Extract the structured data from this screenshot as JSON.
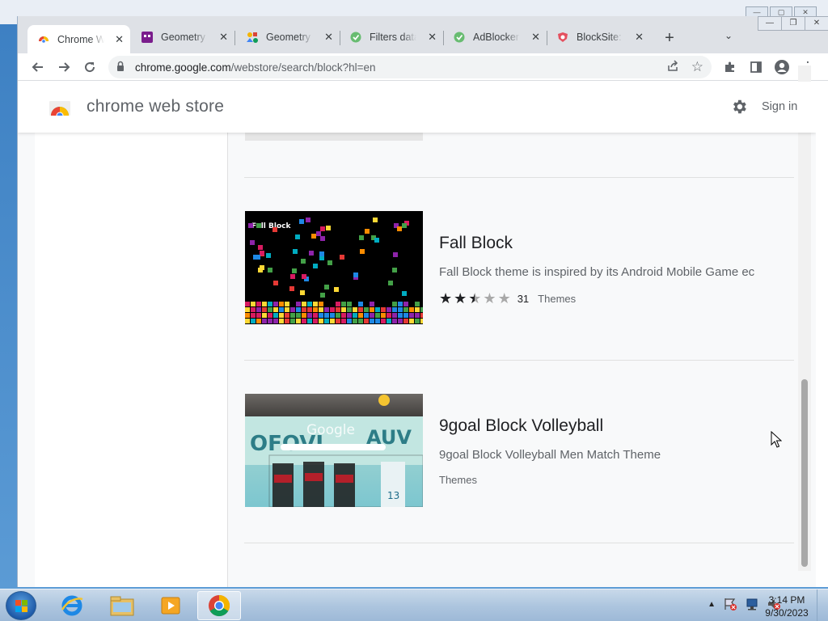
{
  "browser": {
    "tabs": [
      {
        "label": "Chrome Web Store",
        "active": true
      },
      {
        "label": "Geometry Dash",
        "active": false
      },
      {
        "label": "Geometry Dash",
        "active": false
      },
      {
        "label": "Filters database",
        "active": false
      },
      {
        "label": "AdBlocker Stopper",
        "active": false
      },
      {
        "label": "BlockSite: Free",
        "active": false
      }
    ],
    "new_tab_label": "+",
    "url_host": "chrome.google.com",
    "url_rest": "/webstore/search/block?hl=en"
  },
  "store": {
    "title": "chrome web store",
    "sign_in": "Sign in"
  },
  "results": [
    {
      "title": "Fall Block",
      "description": "Fall Block theme is inspired by its Android Mobile Game ec",
      "thumb_label": "Fall Block",
      "rating": 2.5,
      "rating_count": "31",
      "category": "Themes"
    },
    {
      "title": "9goal Block Volleyball",
      "description": "9goal Block Volleyball Men Match Theme",
      "thumb_label": "Google",
      "category": "Themes"
    }
  ],
  "taskbar": {
    "time": "3:14 PM",
    "date": "9/30/2023"
  },
  "colors": {
    "chrome_frame": "#dee1e6",
    "store_bg": "#f8f9fa",
    "text_primary": "#202124",
    "text_secondary": "#5f6368"
  }
}
